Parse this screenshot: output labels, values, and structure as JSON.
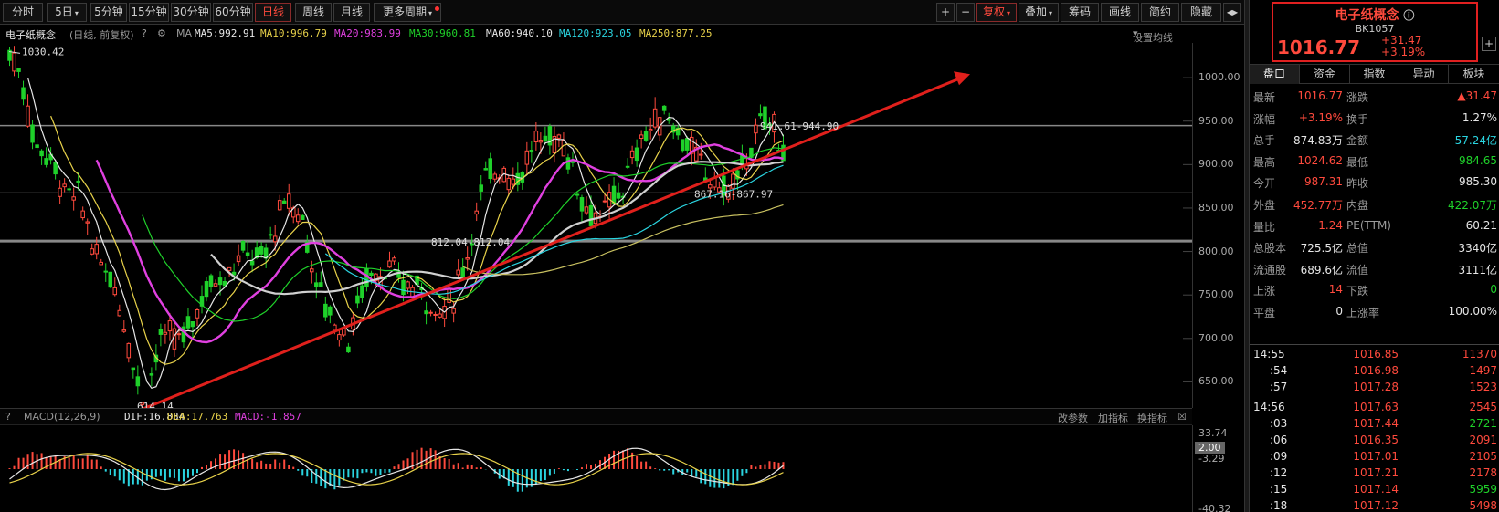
{
  "toolbar": {
    "periods": [
      "分时",
      "5日",
      "5分钟",
      "15分钟",
      "30分钟",
      "60分钟",
      "日线",
      "周线",
      "月线",
      "更多周期"
    ],
    "active_period": "日线",
    "right_buttons": [
      "+",
      "−",
      "复权",
      "叠加",
      "筹码",
      "画线",
      "简约",
      "隐藏",
      "◀▶"
    ]
  },
  "info": {
    "name": "电子纸概念",
    "adjust": "(日线, 前复权)",
    "ma_label": "MA",
    "ma5": "MA5:992.91",
    "ma10": "MA10:996.79",
    "ma20": "MA20:983.99",
    "ma30": "MA30:960.81",
    "ma60": "MA60:940.10",
    "ma120": "MA120:923.05",
    "ma250": "MA250:877.25",
    "settings": "设置均线"
  },
  "price_axis": [
    "1000.00",
    "950.00",
    "900.00",
    "850.00",
    "800.00",
    "750.00",
    "700.00",
    "650.00"
  ],
  "annotations": {
    "high": "1030.42",
    "low": "614.14",
    "line1": "941.61-944.90",
    "line2": "867.16-867.97",
    "line3": "812.04-812.04"
  },
  "macd": {
    "label": "MACD(12,26,9)",
    "dif": "DIF:16.834",
    "dea": "DEA:17.763",
    "macd": "MACD:-1.857",
    "actions": [
      "改参数",
      "加指标",
      "换指标"
    ],
    "axis": [
      "33.74",
      "2.00",
      "-3.29",
      "-40.32"
    ]
  },
  "colors": {
    "up": "#ff4a3d",
    "down": "#1fd12a",
    "ma5": "#e6e6e6",
    "ma10": "#e8d24a",
    "ma20": "#e040e0",
    "ma30": "#1fd12a",
    "ma60": "#d0d0d0",
    "ma120": "#2ad4e0",
    "ma250": "#c8c060"
  },
  "quote": {
    "name": "电子纸概念",
    "code": "BK1057",
    "price": "1016.77",
    "change": "+31.47",
    "pct": "+3.19%"
  },
  "tabs": [
    "盘口",
    "资金",
    "指数",
    "异动",
    "板块"
  ],
  "stats": [
    [
      "最新",
      "1016.77",
      "涨跌",
      "▲31.47"
    ],
    [
      "涨幅",
      "+3.19%",
      "换手",
      "1.27%"
    ],
    [
      "总手",
      "874.83万",
      "金额",
      "57.24亿"
    ],
    [
      "最高",
      "1024.62",
      "最低",
      "984.65"
    ],
    [
      "今开",
      "987.31",
      "昨收",
      "985.30"
    ],
    [
      "外盘",
      "452.77万",
      "内盘",
      "422.07万"
    ],
    [
      "量比",
      "1.24",
      "PE(TTM)",
      "60.21"
    ],
    [
      "总股本",
      "725.5亿",
      "总值",
      "3340亿"
    ],
    [
      "流通股",
      "689.6亿",
      "流值",
      "3111亿"
    ],
    [
      "上涨",
      "14",
      "下跌",
      "0"
    ],
    [
      "平盘",
      "0",
      "上涨率",
      "100.00%"
    ]
  ],
  "ticks": [
    [
      "14:55",
      "1016.85",
      "11370"
    ],
    [
      ":54",
      "1016.98",
      "1497"
    ],
    [
      ":57",
      "1017.28",
      "1523"
    ],
    [
      "14:56",
      "1017.63",
      "2545"
    ],
    [
      ":03",
      "1017.44",
      "2721"
    ],
    [
      ":06",
      "1016.35",
      "2091"
    ],
    [
      ":09",
      "1017.01",
      "2105"
    ],
    [
      ":12",
      "1017.21",
      "2178"
    ],
    [
      ":15",
      "1017.14",
      "5959"
    ],
    [
      ":18",
      "1017.12",
      "5498"
    ]
  ],
  "chart_data": {
    "type": "candlestick",
    "y_range": [
      620,
      1040
    ],
    "trend_line_start": [
      0.135,
      614
    ],
    "trend_line_end": [
      0.82,
      1000
    ]
  }
}
